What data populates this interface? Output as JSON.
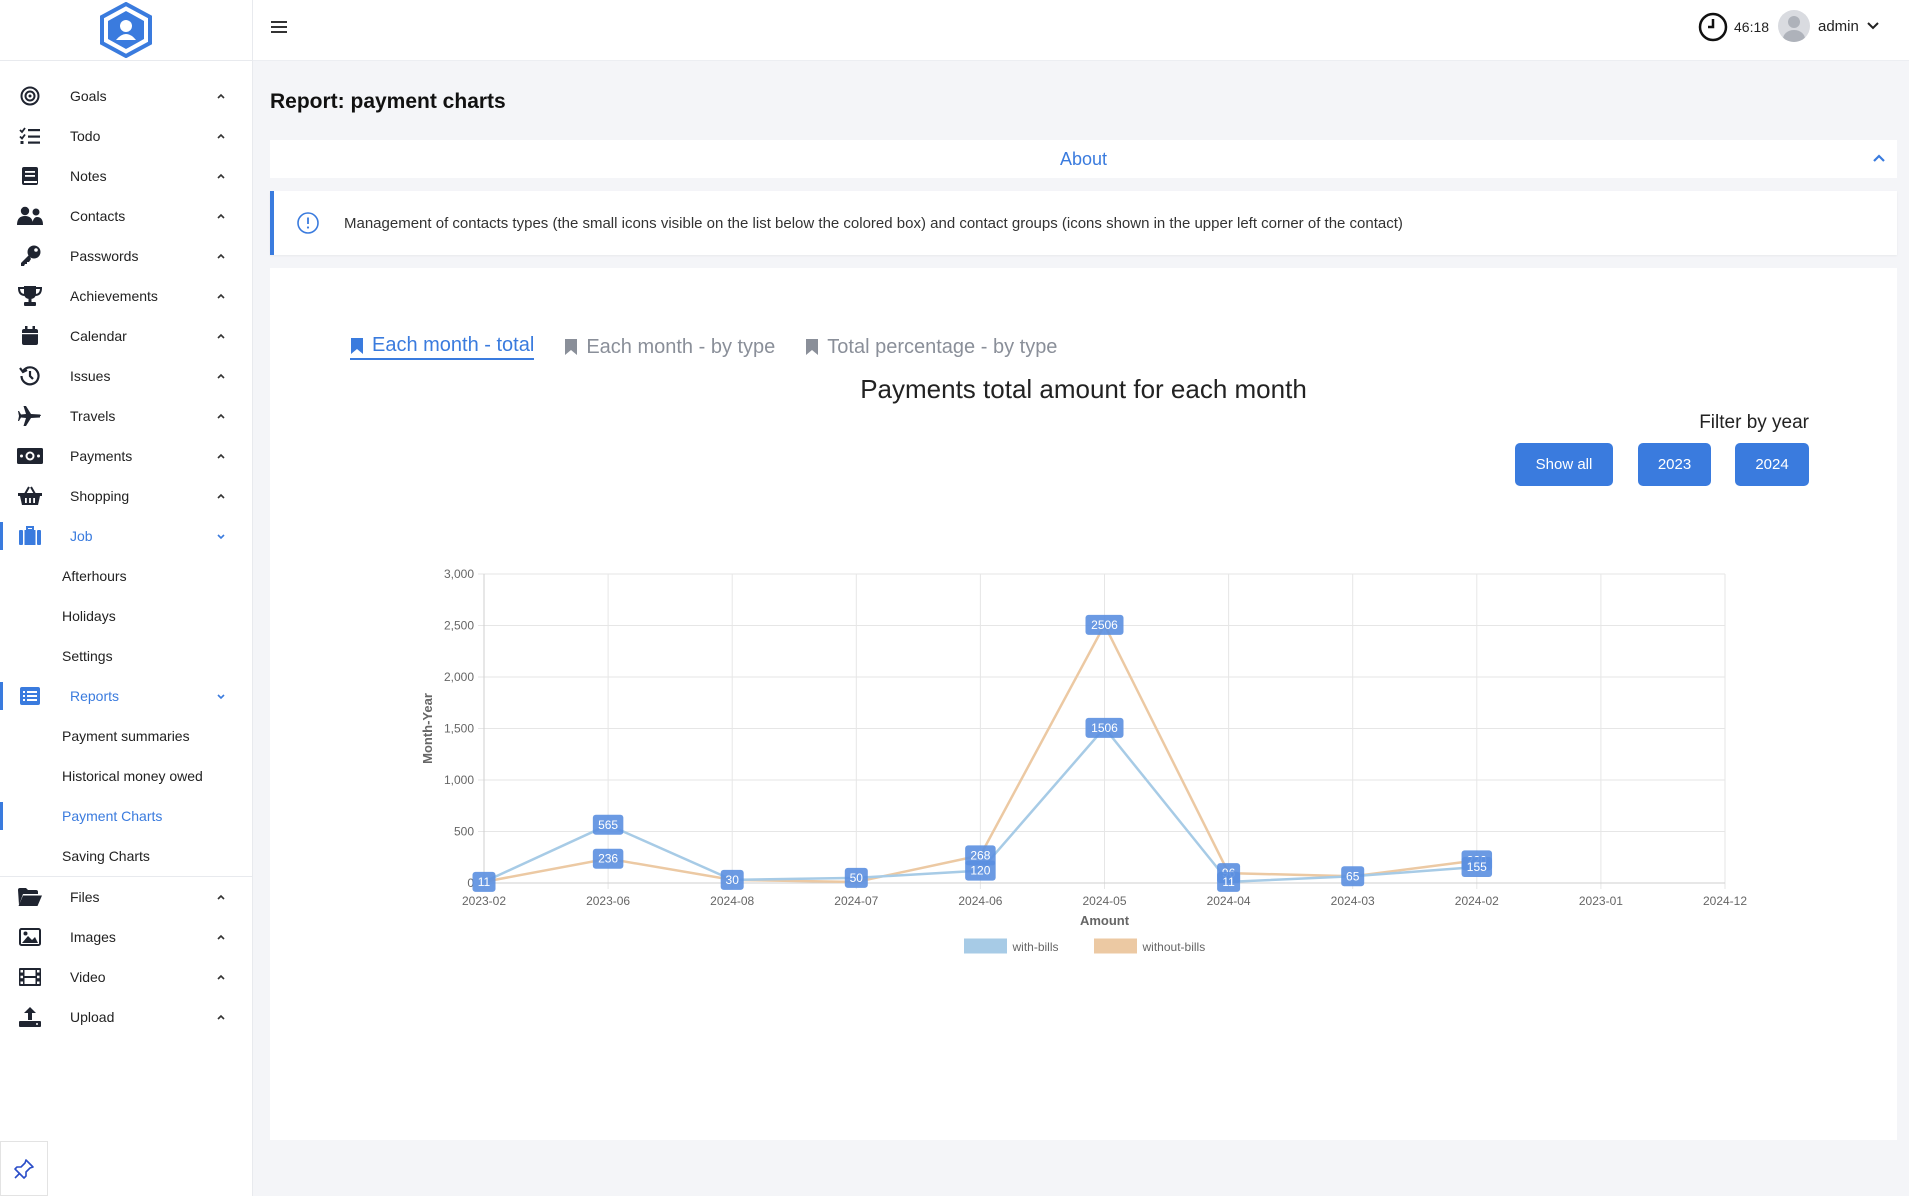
{
  "app": {
    "timer": "46:18",
    "user": "admin",
    "page_title": "Report: payment charts"
  },
  "sidebar": {
    "items": [
      {
        "label": "Goals",
        "icon": "target-icon"
      },
      {
        "label": "Todo",
        "icon": "checklist-icon"
      },
      {
        "label": "Notes",
        "icon": "notebook-icon"
      },
      {
        "label": "Contacts",
        "icon": "users-icon"
      },
      {
        "label": "Passwords",
        "icon": "key-icon"
      },
      {
        "label": "Achievements",
        "icon": "trophy-icon"
      },
      {
        "label": "Calendar",
        "icon": "calendar-icon"
      },
      {
        "label": "Issues",
        "icon": "history-icon"
      },
      {
        "label": "Travels",
        "icon": "plane-icon"
      },
      {
        "label": "Payments",
        "icon": "money-icon"
      },
      {
        "label": "Shopping",
        "icon": "basket-icon"
      },
      {
        "label": "Job",
        "icon": "briefcase-icon"
      }
    ],
    "job_sub": [
      "Afterhours",
      "Holidays",
      "Settings"
    ],
    "reports": {
      "label": "Reports",
      "icon": "list-icon"
    },
    "reports_sub": [
      "Payment summaries",
      "Historical money owed",
      "Payment Charts",
      "Saving Charts"
    ],
    "bottom_items": [
      {
        "label": "Files",
        "icon": "folder-icon"
      },
      {
        "label": "Images",
        "icon": "image-icon"
      },
      {
        "label": "Video",
        "icon": "film-icon"
      },
      {
        "label": "Upload",
        "icon": "upload-icon"
      }
    ]
  },
  "about": {
    "title": "About",
    "text": "Management of contacts types (the small icons visible on the list below the colored box) and contact groups (icons shown in the upper left corner of the contact)"
  },
  "tabs": [
    "Each month - total",
    "Each month - by type",
    "Total percentage - by type"
  ],
  "filter": {
    "label": "Filter by year",
    "buttons": [
      "Show all",
      "2023",
      "2024"
    ]
  },
  "colors": {
    "accent": "#3a7bde",
    "with_bills": "#a7cbe6",
    "without_bills": "#ecc9a3"
  },
  "chart_data": {
    "type": "line",
    "title": "Payments total amount for each month",
    "xlabel": "Amount",
    "ylabel": "Month-Year",
    "categories": [
      "2023-02",
      "2023-06",
      "2024-08",
      "2024-07",
      "2024-06",
      "2024-05",
      "2024-04",
      "2024-03",
      "2024-02",
      "2023-01",
      "2024-12"
    ],
    "ylim": [
      0,
      3000
    ],
    "yticks": [
      "0",
      "500",
      "1,000",
      "1,500",
      "2,000",
      "2,500",
      "3,000"
    ],
    "grid": true,
    "legend_position": "bottom",
    "series": [
      {
        "name": "with-bills",
        "values": [
          11,
          565,
          30,
          50,
          120,
          1506,
          11,
          65,
          155,
          null,
          null
        ]
      },
      {
        "name": "without-bills",
        "values": [
          11,
          236,
          30,
          10,
          268,
          2506,
          96,
          65,
          220,
          null,
          null
        ]
      }
    ],
    "data_labels": [
      {
        "series": 0,
        "index": 0,
        "text": "11"
      },
      {
        "series": 1,
        "index": 1,
        "text": "236"
      },
      {
        "series": 0,
        "index": 1,
        "text": "565"
      },
      {
        "series": 0,
        "index": 2,
        "text": "30"
      },
      {
        "series": 0,
        "index": 3,
        "text": "50"
      },
      {
        "series": 1,
        "index": 4,
        "text": "268"
      },
      {
        "series": 0,
        "index": 4,
        "text": "120"
      },
      {
        "series": 1,
        "index": 5,
        "text": "2506"
      },
      {
        "series": 0,
        "index": 5,
        "text": "1506"
      },
      {
        "series": 1,
        "index": 6,
        "text": "96"
      },
      {
        "series": 0,
        "index": 6,
        "text": "11"
      },
      {
        "series": 0,
        "index": 7,
        "text": "65"
      },
      {
        "series": 1,
        "index": 8,
        "text": "220"
      },
      {
        "series": 0,
        "index": 8,
        "text": "155"
      }
    ]
  }
}
